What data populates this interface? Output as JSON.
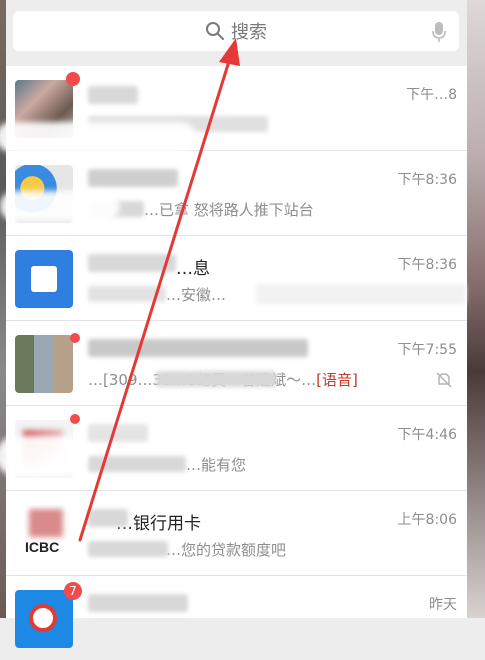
{
  "search": {
    "placeholder": "搜索"
  },
  "chats": [
    {
      "time": "下午…8",
      "preview": "",
      "title": ""
    },
    {
      "time": "下午8:36",
      "title": "",
      "preview": "…已拿 怒将路人推下站台"
    },
    {
      "time": "下午8:36",
      "title": "…息",
      "preview": "…安徽…"
    },
    {
      "time": "下午7:55",
      "title": "",
      "preview_prefix": "…[309…35…1幻员～谷建斌～…",
      "preview_tag": "[语音]"
    },
    {
      "time": "下午4:46",
      "title": "",
      "preview": "…能有您"
    },
    {
      "time": "上午8:06",
      "title": "…银行用卡",
      "preview": "…您的贷款额度吧",
      "avatar_text": "ICBC"
    },
    {
      "time": "昨天",
      "title": "",
      "preview": "",
      "badge": "7"
    }
  ],
  "colors": {
    "accent_red": "#f24b4b",
    "annotation_arrow": "#e53935",
    "time_gray": "#8e8e8e",
    "voice_red": "#c0392b"
  },
  "icons": {
    "search": "search-icon",
    "mic": "microphone-icon",
    "mute": "mute-bell-icon"
  }
}
